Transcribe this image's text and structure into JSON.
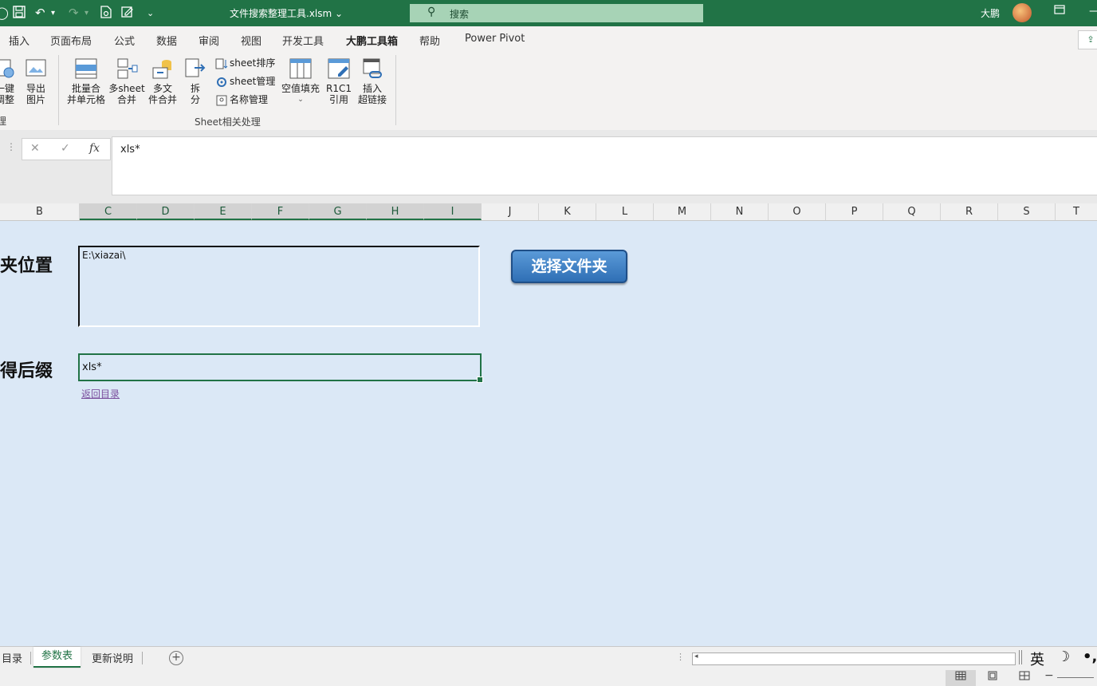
{
  "titlebar": {
    "filename": "文件搜索整理工具.xlsm",
    "dropdown": "⌄",
    "search_placeholder": "搜索",
    "user": "大鹏",
    "save_icon": "save-icon",
    "undo_icon": "undo-icon",
    "redo_icon": "redo-icon"
  },
  "tabs": [
    "插入",
    "页面布局",
    "公式",
    "数据",
    "审阅",
    "视图",
    "开发工具",
    "大鹏工具箱",
    "帮助",
    "Power Pivot"
  ],
  "ribbon": {
    "btn_yijian": "一键\n调整",
    "btn_export": "导出\n图片",
    "left_group_label": "理",
    "btn_merge_cells": "批量合\n并单元格",
    "btn_multi_sheet": "多sheet\n合并",
    "btn_multi_file": "多文\n件合并",
    "btn_split": "拆\n分",
    "sheet_sort": "sheet排序",
    "sheet_manage": "sheet管理",
    "name_manage": "名称管理",
    "btn_fill_empty": "空值填充",
    "btn_r1c1": "R1C1\n引用",
    "btn_hyperlink": "插入\n超链接",
    "group_label": "Sheet相关处理"
  },
  "formula_bar": {
    "cancel": "✕",
    "confirm": "✓",
    "fx": "fx",
    "value": "xls*"
  },
  "columns": [
    "B",
    "C",
    "D",
    "E",
    "F",
    "G",
    "H",
    "I",
    "J",
    "K",
    "L",
    "M",
    "N",
    "O",
    "P",
    "Q",
    "R",
    "S",
    "T"
  ],
  "selected_columns": [
    "C",
    "D",
    "E",
    "F",
    "G",
    "H",
    "I"
  ],
  "sheet": {
    "label_folder": "夹位置",
    "folder_value": "E:\\xiazai\\",
    "label_suffix": "得后缀",
    "suffix_value": "xls*",
    "back_link": "返回目录",
    "pick_folder_button": "选择文件夹"
  },
  "sheet_tabs": {
    "items": [
      "目录",
      "参数表",
      "更新说明"
    ],
    "active": "参数表"
  },
  "ime": {
    "lang": "英",
    "moon": "☽",
    "punct": "•,"
  },
  "colors": {
    "excel_green": "#217346",
    "sheet_bg": "#dbe8f6",
    "button_blue": "#2f6fb5",
    "link_purple": "#7b4f9e"
  }
}
